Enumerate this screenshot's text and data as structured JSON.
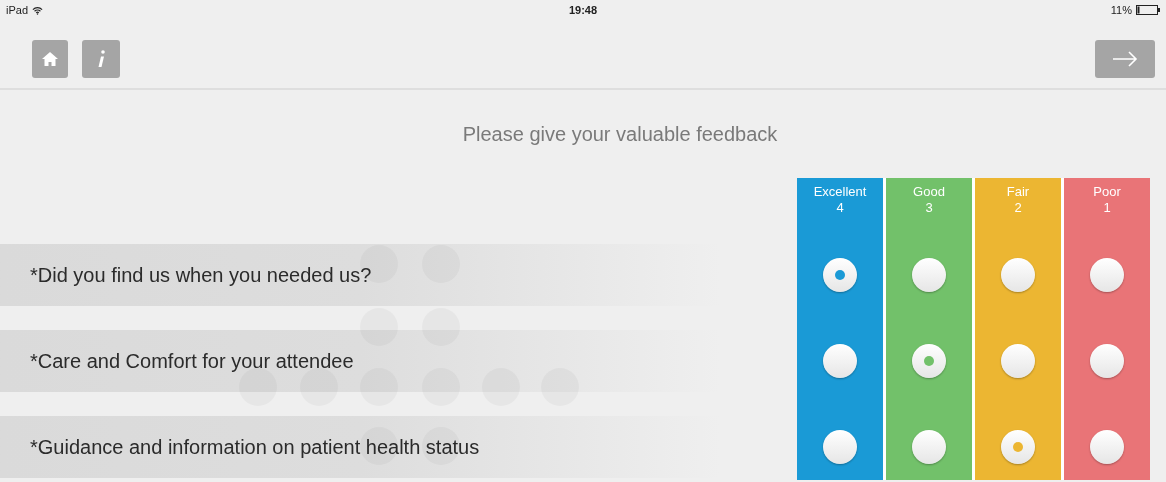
{
  "status_bar": {
    "device": "iPad",
    "time": "19:48",
    "battery": "11%"
  },
  "title": "Please give your valuable feedback",
  "ratings": [
    {
      "label": "Excellent",
      "value": "4",
      "color": "#1a9ad6"
    },
    {
      "label": "Good",
      "value": "3",
      "color": "#72c16a"
    },
    {
      "label": "Fair",
      "value": "2",
      "color": "#ecb632"
    },
    {
      "label": "Poor",
      "value": "1",
      "color": "#e97477"
    }
  ],
  "questions": [
    {
      "text": "*Did you find us when you needed us?",
      "choices": [
        {
          "selected": true
        },
        {
          "selected": false
        },
        {
          "selected": false
        },
        {
          "selected": false
        }
      ]
    },
    {
      "text": "*Care and Comfort for your attendee",
      "choices": [
        {
          "selected": false
        },
        {
          "selected": true
        },
        {
          "selected": false
        },
        {
          "selected": false
        }
      ]
    },
    {
      "text": "*Guidance and information on patient health status",
      "choices": [
        {
          "selected": false
        },
        {
          "selected": false
        },
        {
          "selected": true
        },
        {
          "selected": false
        }
      ]
    }
  ]
}
